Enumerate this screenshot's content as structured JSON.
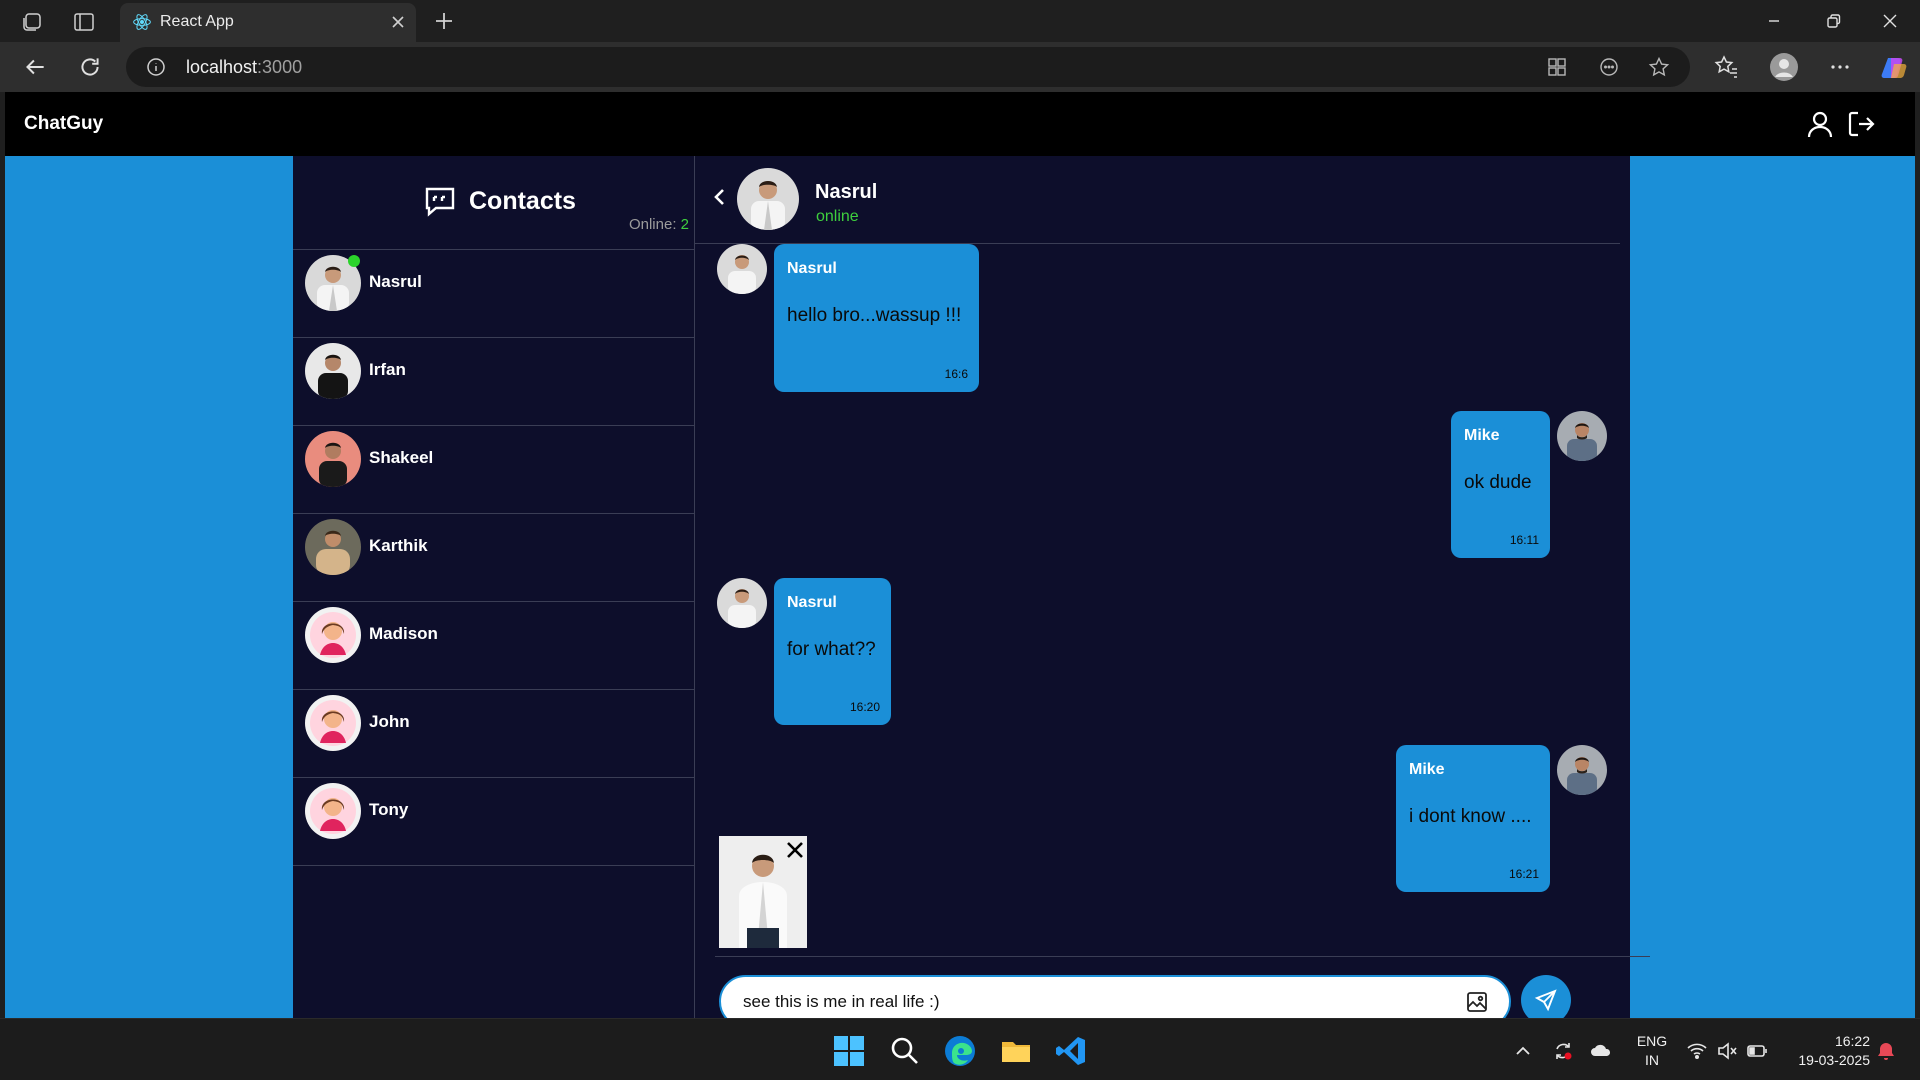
{
  "browser": {
    "tab_title": "React App",
    "url_host": "localhost",
    "url_port": ":3000"
  },
  "app": {
    "brand": "ChatGuy",
    "colors": {
      "accent": "#1b8fd7",
      "panel": "#0d0e2b",
      "online": "#3ecf3e"
    }
  },
  "contacts": {
    "title": "Contacts",
    "online_label": "Online: ",
    "online_count": "2",
    "items": [
      {
        "name": "Nasrul",
        "online": true
      },
      {
        "name": "Irfan"
      },
      {
        "name": "Shakeel"
      },
      {
        "name": "Karthik"
      },
      {
        "name": "Madison"
      },
      {
        "name": "John"
      },
      {
        "name": "Tony"
      }
    ]
  },
  "chat": {
    "name": "Nasrul",
    "status": "online",
    "messages": [
      {
        "sender": "Nasrul",
        "text": "hello bro...wassup !!!",
        "time": "16:6",
        "side": "left"
      },
      {
        "sender": "Mike",
        "text": "ok dude",
        "time": "16:11",
        "side": "right"
      },
      {
        "sender": "Nasrul",
        "text": "for what??",
        "time": "16:20",
        "side": "left"
      },
      {
        "sender": "Mike",
        "text": "i dont know ....",
        "time": "16:21",
        "side": "right"
      }
    ],
    "input_value": "see this is me in real life :)"
  },
  "taskbar": {
    "lang_top": "ENG",
    "lang_bottom": "IN",
    "time": "16:22",
    "date": "19-03-2025"
  }
}
